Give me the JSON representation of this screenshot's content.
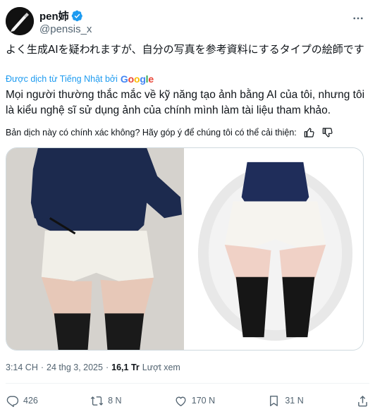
{
  "author": {
    "display_name": "pen姉",
    "handle": "@pensis_x",
    "verified_color": "#1d9bf0"
  },
  "tweet": {
    "text": "よく生成AIを疑われますが、自分の写真を参考資料にするタイプの絵師です",
    "translated_by_label": "Được dịch từ Tiếng Nhật bởi",
    "translator": "Google",
    "translated_text": "Mọi người thường thắc mắc về kỹ năng tạo ảnh bằng AI của tôi, nhưng tôi là kiểu nghệ sĩ sử dụng ảnh của chính mình làm tài liệu tham khảo.",
    "feedback_prompt": "Bản dịch này có chính xác không? Hãy góp ý để chúng tôi có thể cải thiện:"
  },
  "meta": {
    "time": "3:14 CH",
    "separator": "·",
    "date": "24 thg 3, 2025",
    "views_count": "16,1 Tr",
    "views_label": "Lượt xem"
  },
  "actions": {
    "replies": "426",
    "reposts": "8 N",
    "likes": "170 N",
    "bookmarks": "31 N"
  },
  "icons": {
    "more": "more-horizontal-icon",
    "verified": "verified-badge-icon",
    "thumbs_up": "thumbs-up-icon",
    "thumbs_down": "thumbs-down-icon",
    "reply": "reply-icon",
    "repost": "repost-icon",
    "like": "heart-icon",
    "bookmark": "bookmark-icon",
    "share": "share-icon"
  },
  "colors": {
    "link_blue": "#1d9bf0",
    "secondary_text": "#536471"
  }
}
